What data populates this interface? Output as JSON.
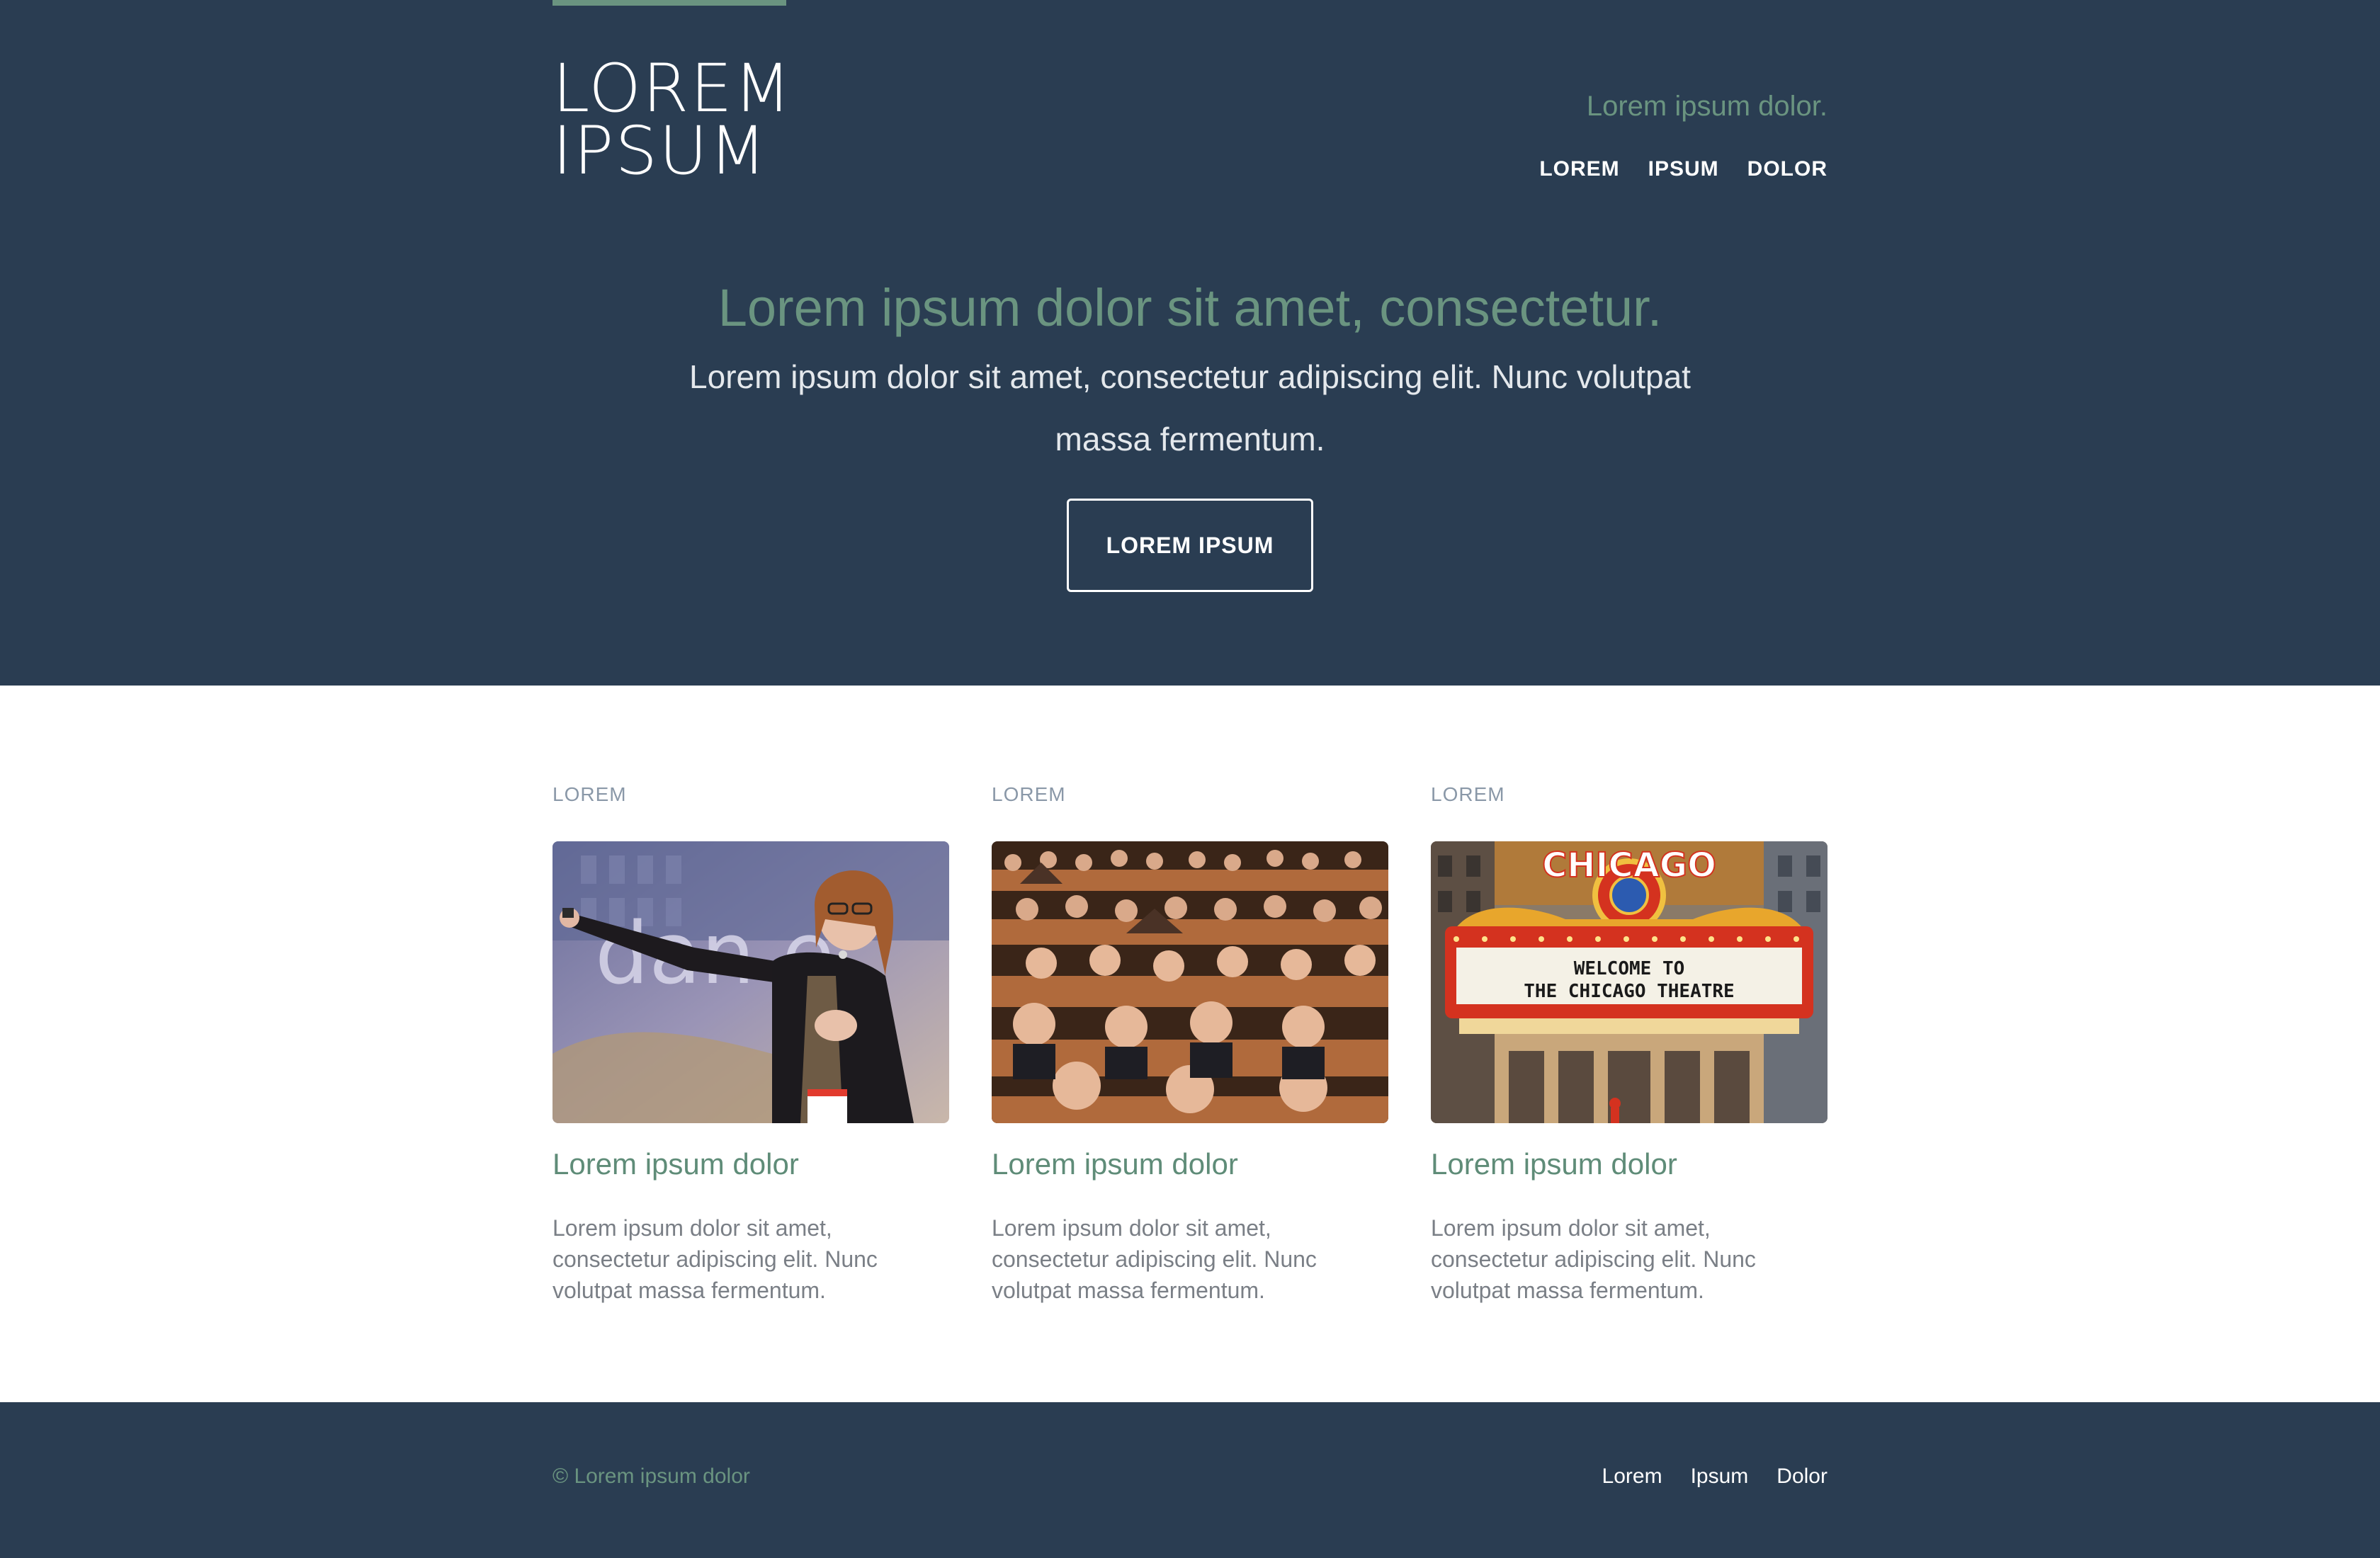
{
  "header": {
    "logo_line1": "LOREM",
    "logo_line2": "IPSUM",
    "tagline": "Lorem ipsum dolor.",
    "nav": [
      "LOREM",
      "IPSUM",
      "DOLOR"
    ]
  },
  "hero": {
    "title": "Lorem ipsum dolor sit amet, consectetur.",
    "subtitle": "Lorem ipsum dolor sit amet, consectetur adipiscing elit. Nunc volutpat massa fermentum.",
    "button_label": "LOREM IPSUM"
  },
  "features": [
    {
      "eyebrow": "LOREM",
      "title": "Lorem ipsum dolor",
      "text": "Lorem ipsum dolor sit amet, consectetur adipiscing elit. Nunc volutpat massa fermentum."
    },
    {
      "eyebrow": "LOREM",
      "title": "Lorem ipsum dolor",
      "text": "Lorem ipsum dolor sit amet, consectetur adipiscing elit. Nunc volutpat massa fermentum."
    },
    {
      "eyebrow": "LOREM",
      "title": "Lorem ipsum dolor",
      "text": "Lorem ipsum dolor sit amet, consectetur adipiscing elit. Nunc volutpat massa fermentum.",
      "marquee_sign": "CHICAGO",
      "marquee_line1": "WELCOME  TO",
      "marquee_line2": "THE CHICAGO  THEATRE"
    }
  ],
  "footer": {
    "copyright": "© Lorem ipsum dolor",
    "nav": [
      "Lorem",
      "Ipsum",
      "Dolor"
    ]
  },
  "colors": {
    "navy": "#2a3d52",
    "sage": "#6a9480",
    "white": "#ffffff"
  }
}
